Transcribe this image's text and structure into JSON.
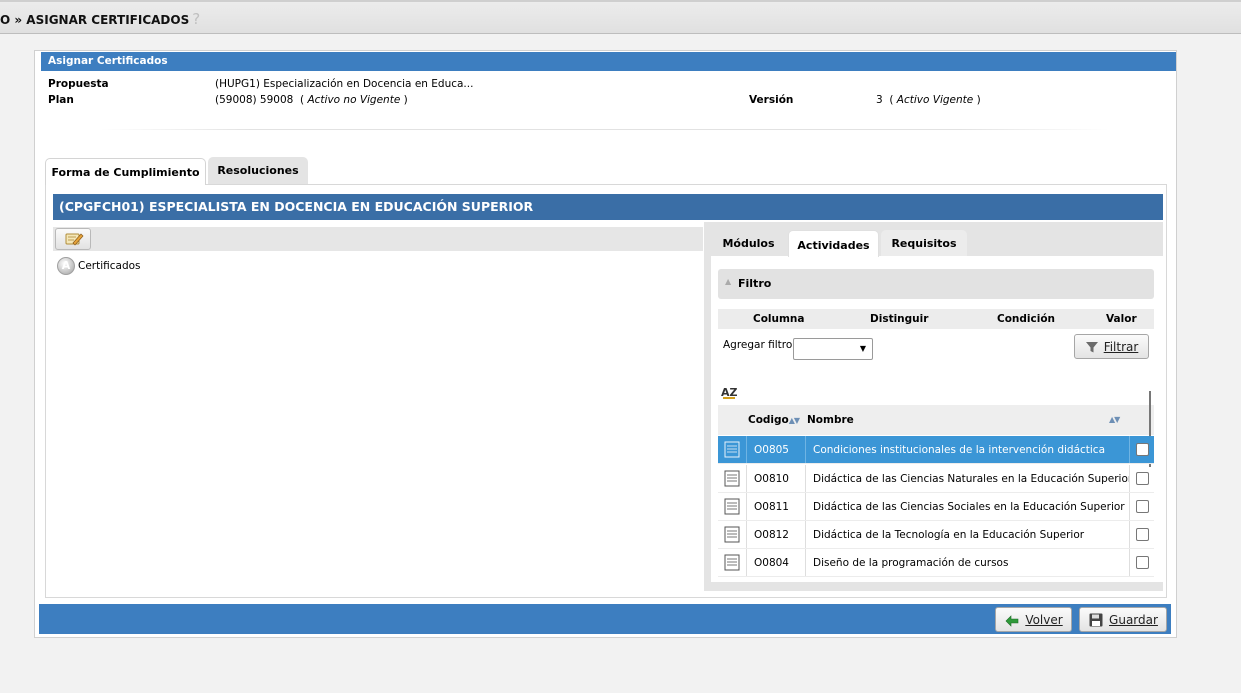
{
  "breadcrumb": {
    "text": "O » ASIGNAR CERTIFICADOS",
    "help": "?"
  },
  "panel": {
    "title": "Asignar Certificados",
    "propuesta_label": "Propuesta",
    "propuesta_value": "(HUPG1) Especialización en Docencia en Educa...",
    "plan_label": "Plan",
    "plan_value": "(59008) 59008",
    "plan_status": "Activo no Vigente",
    "version_label": "Versión",
    "version_value": "3",
    "version_status": "Activo Vigente"
  },
  "tabs": [
    {
      "label": "Forma de Cumplimiento",
      "active": true
    },
    {
      "label": "Resoluciones",
      "active": false
    }
  ],
  "section_title": "(CPGFCH01) ESPECIALISTA EN DOCENCIA EN EDUCACIÓN SUPERIOR",
  "tree": {
    "badge": "A",
    "label": "Certificados"
  },
  "inner_tabs": [
    {
      "label": "Módulos",
      "active": false
    },
    {
      "label": "Actividades",
      "active": true
    },
    {
      "label": "Requisitos",
      "active": false
    }
  ],
  "filter": {
    "title": "Filtro",
    "columns": [
      "Columna",
      "Distinguir",
      "Condición",
      "Valor"
    ],
    "add_label": "Agregar filtro",
    "select_value": "",
    "button_label": "Filtrar"
  },
  "sort_icon": "AZ",
  "grid": {
    "headers": {
      "code": "Codigo",
      "name": "Nombre"
    },
    "rows": [
      {
        "code": "O0805",
        "name": "Condiciones institucionales de la intervención didáctica",
        "selected": true,
        "checked": false
      },
      {
        "code": "O0810",
        "name": "Didáctica de las Ciencias Naturales en la Educación Superior",
        "selected": false,
        "checked": false
      },
      {
        "code": "O0811",
        "name": "Didáctica de las Ciencias Sociales en la Educación Superior",
        "selected": false,
        "checked": false
      },
      {
        "code": "O0812",
        "name": "Didáctica de la Tecnología en la Educación Superior",
        "selected": false,
        "checked": false
      },
      {
        "code": "O0804",
        "name": "Diseño de la programación de cursos",
        "selected": false,
        "checked": false
      }
    ]
  },
  "actions": {
    "back_label": "Volver",
    "save_label": "Guardar"
  },
  "colors": {
    "header_blue": "#3d7ec0",
    "section_blue": "#3a6ea6",
    "selected_row": "#3b96d6"
  }
}
